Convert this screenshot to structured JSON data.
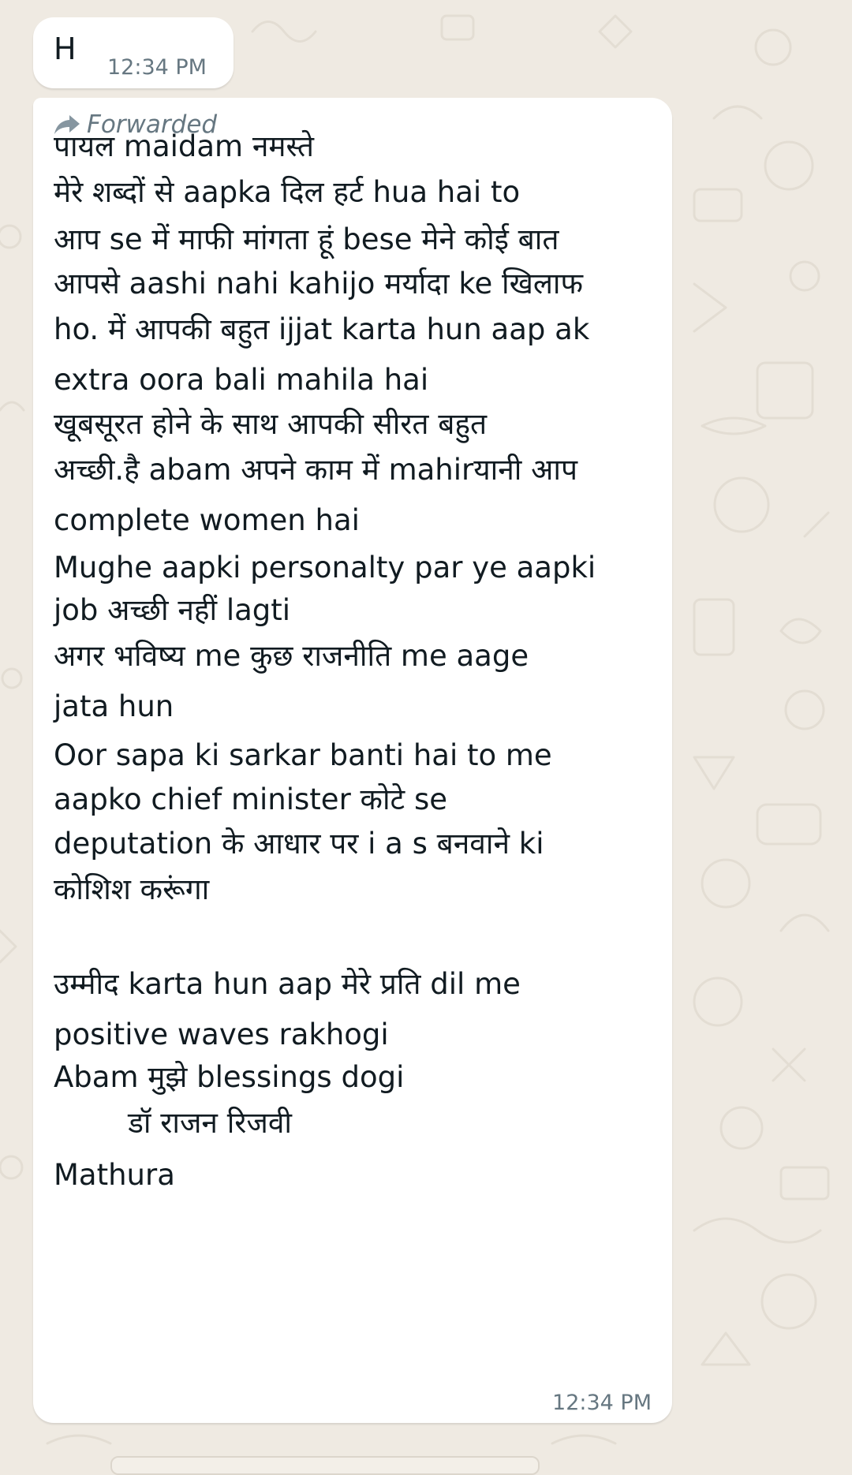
{
  "chat": {
    "background_color": "#efeae2",
    "bubble_color": "#ffffff",
    "text_color": "#111b21",
    "meta_color": "#667781"
  },
  "messages": [
    {
      "text": "H",
      "time": "12:34 PM"
    },
    {
      "forwarded_label": "Forwarded",
      "forward_icon": "forward-arrow-icon",
      "lines": [
        "पायल  maidam  नमस्ते",
        "मेरे  शब्दों से  aapka दिल हर्ट hua  hai to",
        "आप se में माफी मांगता  हूं  bese मेने कोई बात",
        "आपसे  aashi nahi kahijo मर्यादा ke खिलाफ",
        "ho. में आपकी बहुत ijjat  karta hun  aap ak",
        "extra  oora bali mahila hai",
        "खूबसूरत होने के साथ  आपकी सीरत बहुत",
        "अच्छी.है  abam अपने काम में mahirयानी आप",
        "complete women hai",
        "Mughe aapki personalty  par ye aapki",
        "job अच्छी नहीं lagti",
        "अगर भविष्य  me कुछ  राजनीति me aage",
        "jata hun",
        "Oor sapa ki sarkar banti hai to me",
        "aapko chief minister  कोटे se",
        "deputation  के आधार पर i a s बनवाने ki",
        "कोशिश करूंगा",
        "",
        "उम्मीद  karta hun  aap मेरे प्रति  dil  me",
        "positive waves rakhogi",
        "Abam मुझे blessings dogi",
        "        डॉ राजन रिजवी",
        "Mathura"
      ],
      "time": "12:34 PM"
    }
  ]
}
